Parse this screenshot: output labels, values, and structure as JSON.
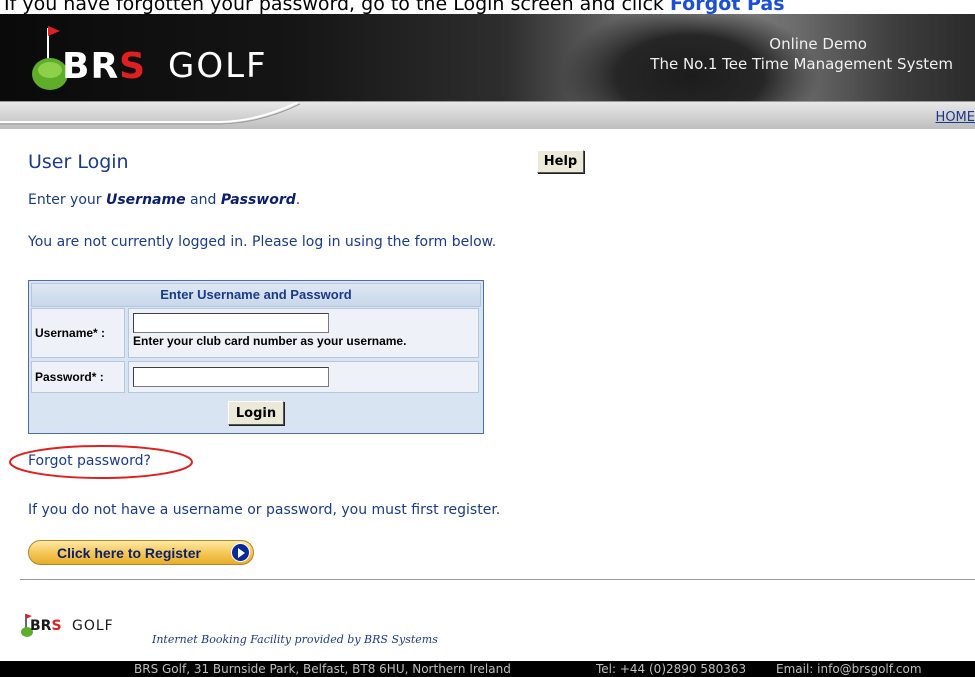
{
  "instruction": {
    "text": "If you have forgotten your password, go to the Login screen and click ",
    "link": "Forgot Pas"
  },
  "banner": {
    "logo_brs_prefix": "BR",
    "logo_brs_s": "S",
    "logo_golf": "GOLF",
    "line1": "Online Demo",
    "line2": "The No.1 Tee Time Management System"
  },
  "nav": {
    "home": "HOME"
  },
  "page": {
    "title": "User Login",
    "help_label": "Help",
    "enter_prefix": "Enter your ",
    "enter_username": "Username",
    "enter_and": " and ",
    "enter_password": "Password",
    "enter_suffix": ".",
    "not_logged_in": "You are not currently logged in. Please log in using the form below."
  },
  "login_form": {
    "header": "Enter Username and Password",
    "username_label": "Username* :",
    "username_value": "",
    "username_hint": "Enter your club card number as your username.",
    "password_label": "Password* :",
    "password_value": "",
    "login_label": "Login"
  },
  "forgot": {
    "label": "Forgot password?"
  },
  "register": {
    "text": "If you do not have a username or password, you must first register.",
    "button_label": "Click here to Register"
  },
  "footer": {
    "logo_brs_prefix": "BR",
    "logo_brs_s": "S",
    "logo_golf": "GOLF",
    "tagline": "Internet Booking Facility provided by BRS Systems",
    "address": "BRS Golf, 31 Burnside Park, Belfast, BT8 6HU, Northern Ireland",
    "tel": "Tel: +44 (0)2890 580363",
    "email": "Email: info@brsgolf.com"
  },
  "colors": {
    "link": "#1a3a8a",
    "accent_red": "#e02020",
    "register_gold": "#f4c85a"
  }
}
